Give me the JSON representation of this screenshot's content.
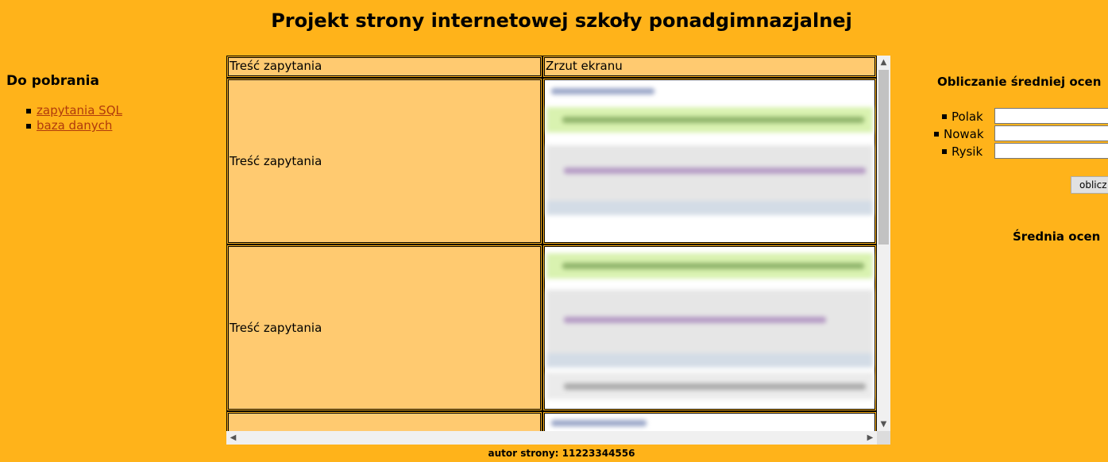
{
  "page": {
    "title": "Projekt strony internetowej szkoły ponadgimnazjalnej",
    "author": "autor strony: 11223344556"
  },
  "downloads": {
    "heading": "Do pobrania",
    "links": [
      "zapytania SQL",
      "baza danych"
    ]
  },
  "table": {
    "headers": [
      "Treść zapytania",
      "Zrzut ekranu"
    ],
    "rows": [
      {
        "query": "Treść zapytania",
        "screenshot": "blurred-screenshot"
      },
      {
        "query": "Treść zapytania",
        "screenshot": "blurred-screenshot"
      },
      {
        "query": "",
        "screenshot": "blurred-screenshot"
      }
    ]
  },
  "average": {
    "heading": "Obliczanie średniej ocen",
    "students": [
      {
        "name": "Polak",
        "value": ""
      },
      {
        "name": "Nowak",
        "value": ""
      },
      {
        "name": "Rysik",
        "value": ""
      }
    ],
    "button": "oblicz",
    "result_label": "Średnia ocen"
  },
  "colors": {
    "background": "#FFB31A",
    "cell": "#FFCA70",
    "link": "#B03A0C"
  }
}
